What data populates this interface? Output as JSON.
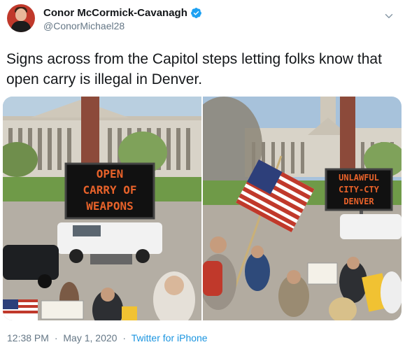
{
  "user": {
    "display_name": "Conor McCormick-Cavanagh",
    "handle": "@ConorMichael28",
    "verified": true,
    "avatar_icon": "profile-photo"
  },
  "tweet": {
    "text": "Signs across from the Capitol steps letting folks know that open carry is illegal in Denver."
  },
  "media": {
    "photo1": {
      "sign_line1": "OPEN",
      "sign_line2": "CARRY OF",
      "sign_line3": "WEAPONS"
    },
    "photo2": {
      "sign_line1": "UNLAWFUL",
      "sign_line2": "CITY-CTY",
      "sign_line3": "DENVER"
    }
  },
  "footer": {
    "time": "12:38 PM",
    "separator": "·",
    "date": "May 1, 2020",
    "source": "Twitter for iPhone"
  },
  "colors": {
    "accent": "#1b95e0",
    "verified": "#1da1f2",
    "secondary_text": "#657786",
    "sign_led": "#e8622a"
  }
}
